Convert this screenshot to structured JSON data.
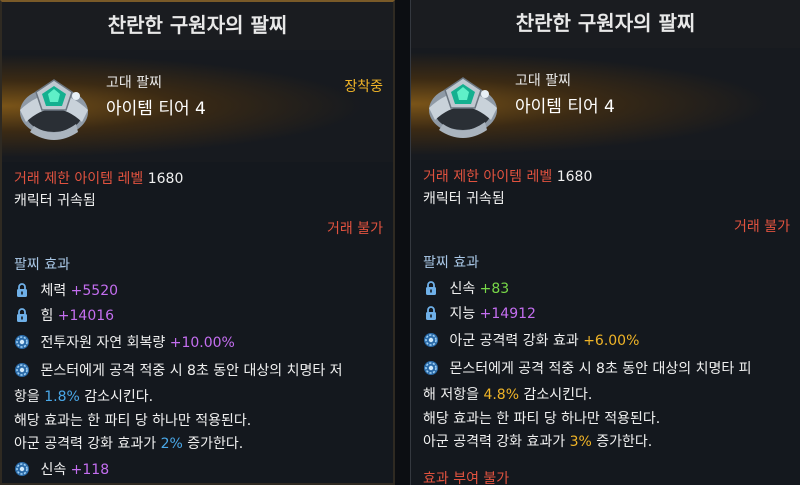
{
  "left": {
    "title": "찬란한 구원자의 팔찌",
    "grade": "고대 팔찌",
    "tier": "아이템 티어 4",
    "equipped": "장착중",
    "trade_level_label": "거래 제한 아이템 레벨",
    "trade_level_value": "1680",
    "bound": "캐릭터 귀속됨",
    "trade_status": "거래 불가",
    "effect_heading": "팔찌 효과",
    "stats": [
      {
        "name": "체력",
        "value": "+5520",
        "icon": "lock-icon"
      },
      {
        "name": "힘",
        "value": "+14016",
        "icon": "lock-icon"
      }
    ],
    "effect1_text": "전투자원 자연 회복량",
    "effect1_value": "+10.00%",
    "effect2_line1": "몬스터에게 공격 적중 시 8초 동안 대상의 치명타 저",
    "effect2_line2a": "항을",
    "effect2_line2b": "1.8%",
    "effect2_line2c": "감소시킨다.",
    "effect2_line3": "해당 효과는 한 파티 당 하나만 적용된다.",
    "effect2_line4a": "아군 공격력 강화 효과가",
    "effect2_line4b": "2%",
    "effect2_line4c": "증가한다.",
    "last_stat_name": "신속",
    "last_stat_value": "+118"
  },
  "right": {
    "title": "찬란한 구원자의 팔찌",
    "grade": "고대 팔찌",
    "tier": "아이템 티어 4",
    "trade_level_label": "거래 제한 아이템 레벨",
    "trade_level_value": "1680",
    "bound": "캐릭터 귀속됨",
    "trade_status": "거래 불가",
    "effect_heading": "팔찌 효과",
    "stats": [
      {
        "name": "신속",
        "value": "+83",
        "icon": "lock-icon"
      },
      {
        "name": "지능",
        "value": "+14912",
        "icon": "lock-icon"
      }
    ],
    "effect1_text": "아군 공격력 강화 효과",
    "effect1_value": "+6.00%",
    "effect2_line1": "몬스터에게 공격 적중 시 8초 동안 대상의 치명타 피",
    "effect2_line2a": "해 저항을",
    "effect2_line2b": "4.8%",
    "effect2_line2c": "감소시킨다.",
    "effect2_line3": "해당 효과는 한 파티 당 하나만 적용된다.",
    "effect2_line4a": "아군 공격력 강화 효과가",
    "effect2_line4b": "3%",
    "effect2_line4c": "증가한다.",
    "no_effect": "효과 부여 불가"
  },
  "colors": {
    "equipped": "#f0b427",
    "restriction": "#e0523f",
    "stat_value": "#c46ef0",
    "stat_value_green": "#78d848",
    "highlight_orange": "#f0b427",
    "highlight_blue": "#4aa8e8"
  }
}
